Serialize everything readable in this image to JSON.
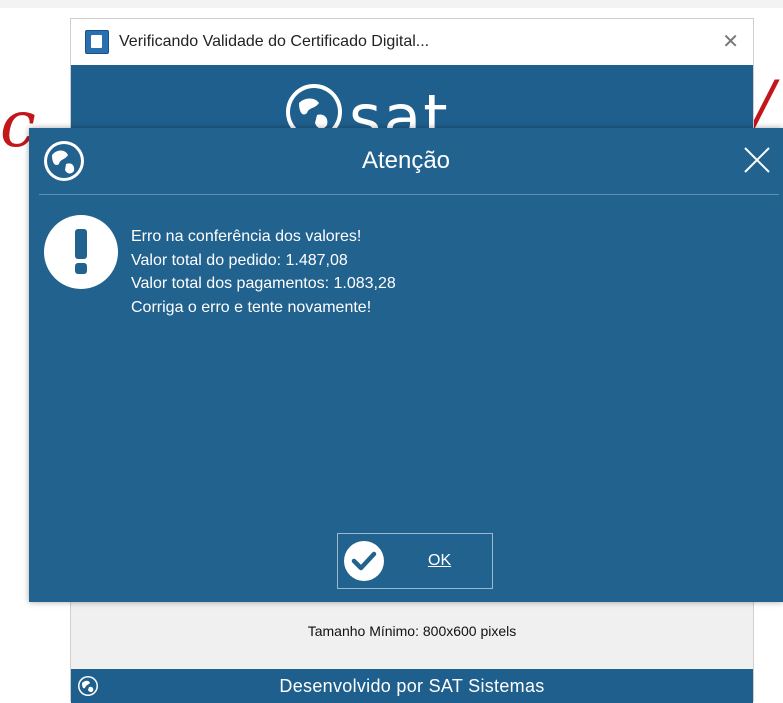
{
  "background": {
    "left_fragment": "c",
    "right_fragment": "/"
  },
  "splash": {
    "title": "Verificando Validade do Certificado Digital...",
    "close_glyph": "✕",
    "logo_text": "sat",
    "min_size_text": "Tamanho Mínimo: 800x600 pixels",
    "footer_text": "Desenvolvido por SAT Sistemas",
    "app_icon": "certificate-icon"
  },
  "dialog": {
    "title": "Atenção",
    "close_glyph": "✕",
    "icon": "exclamation-icon",
    "messages": [
      "Erro na conferência dos valores!",
      "Valor total do pedido: 1.487,08",
      "Valor total dos pagamentos: 1.083,28",
      "Corriga o erro e tente novamente!"
    ],
    "ok_label": "OK"
  },
  "colors": {
    "dialog_blue": "#21628f",
    "banner_blue": "#1f5f8d",
    "brand_red": "#c2161b"
  }
}
